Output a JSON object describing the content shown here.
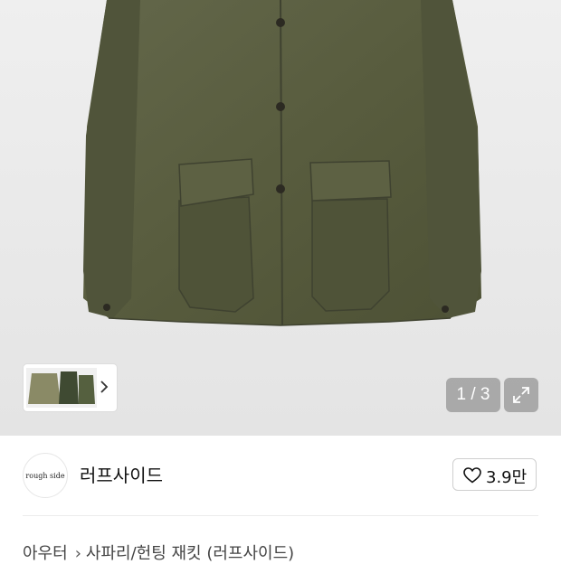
{
  "gallery": {
    "counter": "1 / 3",
    "icons": {
      "expand": "expand-arrows-icon",
      "next": "chevron-right-icon"
    }
  },
  "brand": {
    "logo_text": "rough side",
    "name": "러프사이드"
  },
  "like": {
    "count": "3.9만",
    "icon": "heart-outline-icon"
  },
  "breadcrumb": {
    "category": "아우터",
    "product": "사파리/헌팅 재킷 (러프사이드)"
  },
  "colors": {
    "jacket_olive": "#585c3e",
    "background": "#ffffff",
    "overlay_gray": "#8a8a8a"
  }
}
